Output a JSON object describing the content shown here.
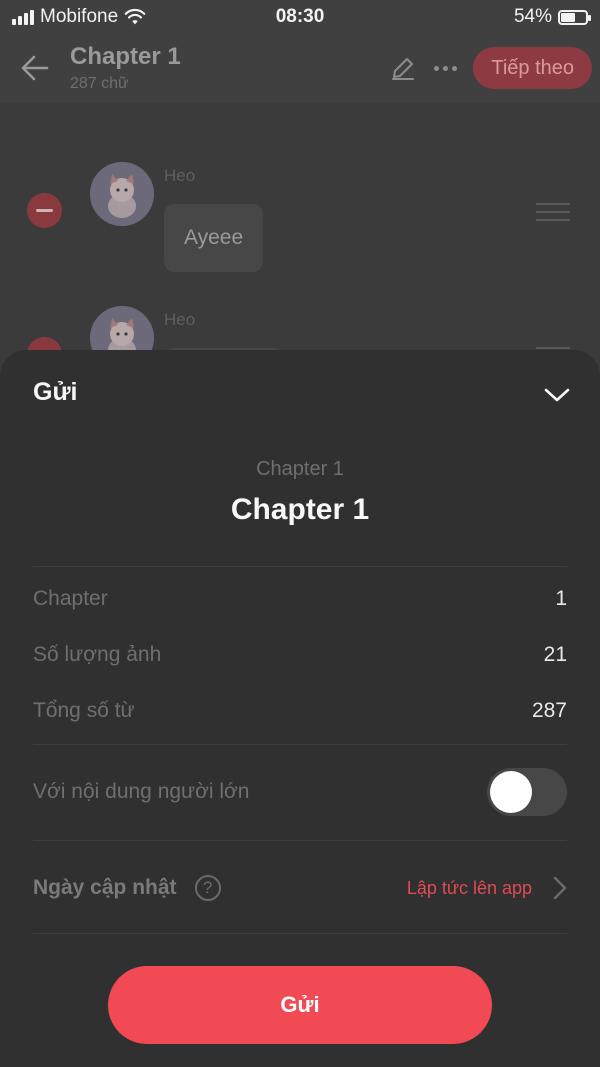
{
  "status_bar": {
    "carrier": "Mobifone",
    "time": "08:30",
    "battery": "54%",
    "battery_level": 0.54
  },
  "top_bar": {
    "title": "Chapter 1",
    "subtitle": "287 chữ",
    "next_label": "Tiếp theo",
    "icons": [
      "arrow-left-icon",
      "pencil-icon",
      "more-dots-icon"
    ]
  },
  "messages": [
    {
      "sender": "Heo",
      "text": "Ayeee"
    },
    {
      "sender": "Heo",
      "text": ""
    }
  ],
  "sheet": {
    "title": "Gửi",
    "chapter_label_small": "Chapter 1",
    "chapter_title": "Chapter 1",
    "rows": [
      {
        "label": "Chapter",
        "value": "1"
      },
      {
        "label": "Số lượng ảnh",
        "value": "21"
      },
      {
        "label": "Tổng số từ",
        "value": "287"
      }
    ],
    "adult_content": {
      "label": "Với nội dung người lớn",
      "enabled": false
    },
    "update_date": {
      "label": "Ngày cập nhật",
      "help": "?",
      "value": "Lập tức lên app"
    },
    "send_label": "Gửi"
  },
  "colors": {
    "accent": "#f24a55",
    "sheet_bg": "#303030",
    "dim_bg": "#3b3b3b"
  }
}
